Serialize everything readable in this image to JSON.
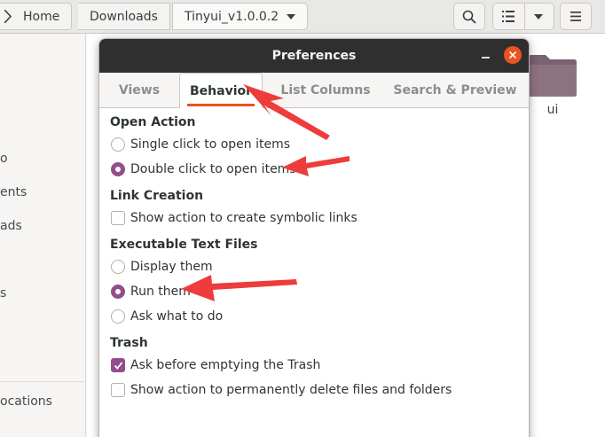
{
  "headerbar": {
    "path": [
      "Home",
      "Downloads",
      "Tinyui_v1.0.0.2"
    ]
  },
  "sidebar": {
    "items": [
      "o",
      "ents",
      "ads",
      "s",
      "ocations"
    ]
  },
  "content": {
    "folder_label": "ui",
    "folder_color": "#8d7380"
  },
  "dialog": {
    "title": "Preferences",
    "tabs": [
      "Views",
      "Behavior",
      "List Columns",
      "Search & Preview"
    ],
    "active_tab": "Behavior",
    "sections": {
      "open_action": {
        "title": "Open Action",
        "options": [
          "Single click to open items",
          "Double click to open items"
        ],
        "selected": "Double click to open items"
      },
      "link_creation": {
        "title": "Link Creation",
        "options": [
          "Show action to create symbolic links"
        ],
        "checked": []
      },
      "executable": {
        "title": "Executable Text Files",
        "options": [
          "Display them",
          "Run them",
          "Ask what to do"
        ],
        "selected": "Run them"
      },
      "trash": {
        "title": "Trash",
        "options": [
          "Ask before emptying the Trash",
          "Show action to permanently delete files and folders"
        ],
        "checked": [
          "Ask before emptying the Trash"
        ]
      }
    }
  },
  "colors": {
    "accent": "#924d8b",
    "close": "#e95420",
    "annotation_arrow": "#ee3b3b"
  }
}
